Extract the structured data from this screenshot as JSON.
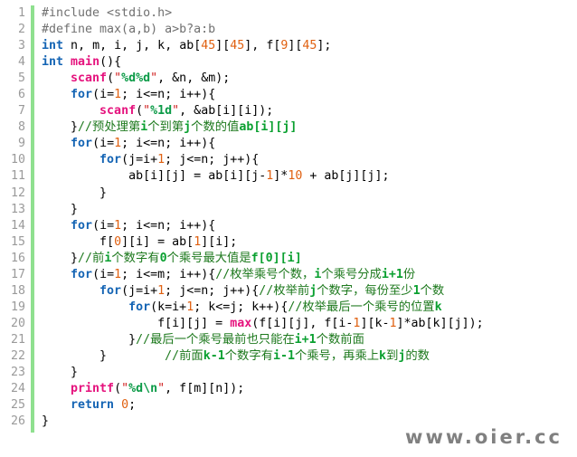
{
  "editor": {
    "language": "C",
    "line_count": 26,
    "colors": {
      "background": "#ffffff",
      "gutter_text": "#9a9a9a",
      "gutter_rule": "#8fe08f",
      "keyword": "#1464b4",
      "function": "#e5127d",
      "string": "#d02020",
      "escape": "#0a9a46",
      "number": "#e06010",
      "preprocessor": "#707070",
      "comment": "#1f7a1f",
      "plain": "#000000",
      "watermark": "#808080"
    },
    "line_numbers": [
      "1",
      "2",
      "3",
      "4",
      "5",
      "6",
      "7",
      "8",
      "9",
      "10",
      "11",
      "12",
      "13",
      "14",
      "15",
      "16",
      "17",
      "18",
      "19",
      "20",
      "21",
      "22",
      "23",
      "24",
      "25",
      "26"
    ],
    "lines": [
      {
        "n": "1",
        "text": "#include <stdio.h>"
      },
      {
        "n": "2",
        "text": "#define max(a,b) a>b?a:b"
      },
      {
        "n": "3",
        "text": "int n, m, i, j, k, ab[45][45], f[9][45];"
      },
      {
        "n": "4",
        "text": "int main(){"
      },
      {
        "n": "5",
        "text": "    scanf(\"%d%d\", &n, &m);"
      },
      {
        "n": "6",
        "text": "    for(i=1; i<=n; i++){"
      },
      {
        "n": "7",
        "text": "        scanf(\"%1d\", &ab[i][i]);"
      },
      {
        "n": "8",
        "text": "    }//预处理第i个到第j个数的值ab[i][j]"
      },
      {
        "n": "9",
        "text": "    for(i=1; i<=n; i++){"
      },
      {
        "n": "10",
        "text": "        for(j=i+1; j<=n; j++){"
      },
      {
        "n": "11",
        "text": "            ab[i][j] = ab[i][j-1]*10 + ab[j][j];"
      },
      {
        "n": "12",
        "text": "        }"
      },
      {
        "n": "13",
        "text": "    }"
      },
      {
        "n": "14",
        "text": "    for(i=1; i<=n; i++){"
      },
      {
        "n": "15",
        "text": "        f[0][i] = ab[1][i];"
      },
      {
        "n": "16",
        "text": "    }//前i个数字有0个乘号最大值是f[0][i]"
      },
      {
        "n": "17",
        "text": "    for(i=1; i<=m; i++){//枚举乘号个数，i个乘号分成i+1份"
      },
      {
        "n": "18",
        "text": "        for(j=i+1; j<=n; j++){//枚举前j个数字，每份至少1个数"
      },
      {
        "n": "19",
        "text": "            for(k=i+1; k<=j; k++){//枚举最后一个乘号的位置k"
      },
      {
        "n": "20",
        "text": "                f[i][j] = max(f[i][j], f[i-1][k-1]*ab[k][j]);"
      },
      {
        "n": "21",
        "text": "            }//最后一个乘号最前也只能在i+1个数前面"
      },
      {
        "n": "22",
        "text": "        }        //前面k-1个数字有i-1个乘号，再乘上k到j的数"
      },
      {
        "n": "23",
        "text": "    }"
      },
      {
        "n": "24",
        "text": "    printf(\"%d\\n\", f[m][n]);"
      },
      {
        "n": "25",
        "text": "    return 0;"
      },
      {
        "n": "26",
        "text": "}"
      }
    ]
  },
  "watermark": {
    "text": "www.oier.cc"
  }
}
